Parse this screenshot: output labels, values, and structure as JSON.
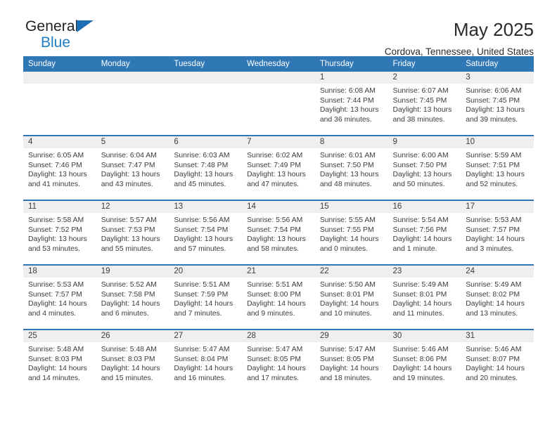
{
  "brand": {
    "name_top": "General",
    "name_bottom": "Blue",
    "triangle_color": "#1b6eb3",
    "blue_text_color": "#1f7fc4"
  },
  "header": {
    "title": "May 2025",
    "location": "Cordova, Tennessee, United States",
    "header_bg_color": "#3077b5",
    "header_text_color": "#ffffff",
    "daynum_band_color": "#efefef"
  },
  "weekday_headers": [
    "Sunday",
    "Monday",
    "Tuesday",
    "Wednesday",
    "Thursday",
    "Friday",
    "Saturday"
  ],
  "weeks": [
    [
      {
        "day": "",
        "sunrise": "",
        "sunset": "",
        "daylight": ""
      },
      {
        "day": "",
        "sunrise": "",
        "sunset": "",
        "daylight": ""
      },
      {
        "day": "",
        "sunrise": "",
        "sunset": "",
        "daylight": ""
      },
      {
        "day": "",
        "sunrise": "",
        "sunset": "",
        "daylight": ""
      },
      {
        "day": "1",
        "sunrise": "Sunrise: 6:08 AM",
        "sunset": "Sunset: 7:44 PM",
        "daylight": "Daylight: 13 hours and 36 minutes."
      },
      {
        "day": "2",
        "sunrise": "Sunrise: 6:07 AM",
        "sunset": "Sunset: 7:45 PM",
        "daylight": "Daylight: 13 hours and 38 minutes."
      },
      {
        "day": "3",
        "sunrise": "Sunrise: 6:06 AM",
        "sunset": "Sunset: 7:45 PM",
        "daylight": "Daylight: 13 hours and 39 minutes."
      }
    ],
    [
      {
        "day": "4",
        "sunrise": "Sunrise: 6:05 AM",
        "sunset": "Sunset: 7:46 PM",
        "daylight": "Daylight: 13 hours and 41 minutes."
      },
      {
        "day": "5",
        "sunrise": "Sunrise: 6:04 AM",
        "sunset": "Sunset: 7:47 PM",
        "daylight": "Daylight: 13 hours and 43 minutes."
      },
      {
        "day": "6",
        "sunrise": "Sunrise: 6:03 AM",
        "sunset": "Sunset: 7:48 PM",
        "daylight": "Daylight: 13 hours and 45 minutes."
      },
      {
        "day": "7",
        "sunrise": "Sunrise: 6:02 AM",
        "sunset": "Sunset: 7:49 PM",
        "daylight": "Daylight: 13 hours and 47 minutes."
      },
      {
        "day": "8",
        "sunrise": "Sunrise: 6:01 AM",
        "sunset": "Sunset: 7:50 PM",
        "daylight": "Daylight: 13 hours and 48 minutes."
      },
      {
        "day": "9",
        "sunrise": "Sunrise: 6:00 AM",
        "sunset": "Sunset: 7:50 PM",
        "daylight": "Daylight: 13 hours and 50 minutes."
      },
      {
        "day": "10",
        "sunrise": "Sunrise: 5:59 AM",
        "sunset": "Sunset: 7:51 PM",
        "daylight": "Daylight: 13 hours and 52 minutes."
      }
    ],
    [
      {
        "day": "11",
        "sunrise": "Sunrise: 5:58 AM",
        "sunset": "Sunset: 7:52 PM",
        "daylight": "Daylight: 13 hours and 53 minutes."
      },
      {
        "day": "12",
        "sunrise": "Sunrise: 5:57 AM",
        "sunset": "Sunset: 7:53 PM",
        "daylight": "Daylight: 13 hours and 55 minutes."
      },
      {
        "day": "13",
        "sunrise": "Sunrise: 5:56 AM",
        "sunset": "Sunset: 7:54 PM",
        "daylight": "Daylight: 13 hours and 57 minutes."
      },
      {
        "day": "14",
        "sunrise": "Sunrise: 5:56 AM",
        "sunset": "Sunset: 7:54 PM",
        "daylight": "Daylight: 13 hours and 58 minutes."
      },
      {
        "day": "15",
        "sunrise": "Sunrise: 5:55 AM",
        "sunset": "Sunset: 7:55 PM",
        "daylight": "Daylight: 14 hours and 0 minutes."
      },
      {
        "day": "16",
        "sunrise": "Sunrise: 5:54 AM",
        "sunset": "Sunset: 7:56 PM",
        "daylight": "Daylight: 14 hours and 1 minute."
      },
      {
        "day": "17",
        "sunrise": "Sunrise: 5:53 AM",
        "sunset": "Sunset: 7:57 PM",
        "daylight": "Daylight: 14 hours and 3 minutes."
      }
    ],
    [
      {
        "day": "18",
        "sunrise": "Sunrise: 5:53 AM",
        "sunset": "Sunset: 7:57 PM",
        "daylight": "Daylight: 14 hours and 4 minutes."
      },
      {
        "day": "19",
        "sunrise": "Sunrise: 5:52 AM",
        "sunset": "Sunset: 7:58 PM",
        "daylight": "Daylight: 14 hours and 6 minutes."
      },
      {
        "day": "20",
        "sunrise": "Sunrise: 5:51 AM",
        "sunset": "Sunset: 7:59 PM",
        "daylight": "Daylight: 14 hours and 7 minutes."
      },
      {
        "day": "21",
        "sunrise": "Sunrise: 5:51 AM",
        "sunset": "Sunset: 8:00 PM",
        "daylight": "Daylight: 14 hours and 9 minutes."
      },
      {
        "day": "22",
        "sunrise": "Sunrise: 5:50 AM",
        "sunset": "Sunset: 8:01 PM",
        "daylight": "Daylight: 14 hours and 10 minutes."
      },
      {
        "day": "23",
        "sunrise": "Sunrise: 5:49 AM",
        "sunset": "Sunset: 8:01 PM",
        "daylight": "Daylight: 14 hours and 11 minutes."
      },
      {
        "day": "24",
        "sunrise": "Sunrise: 5:49 AM",
        "sunset": "Sunset: 8:02 PM",
        "daylight": "Daylight: 14 hours and 13 minutes."
      }
    ],
    [
      {
        "day": "25",
        "sunrise": "Sunrise: 5:48 AM",
        "sunset": "Sunset: 8:03 PM",
        "daylight": "Daylight: 14 hours and 14 minutes."
      },
      {
        "day": "26",
        "sunrise": "Sunrise: 5:48 AM",
        "sunset": "Sunset: 8:03 PM",
        "daylight": "Daylight: 14 hours and 15 minutes."
      },
      {
        "day": "27",
        "sunrise": "Sunrise: 5:47 AM",
        "sunset": "Sunset: 8:04 PM",
        "daylight": "Daylight: 14 hours and 16 minutes."
      },
      {
        "day": "28",
        "sunrise": "Sunrise: 5:47 AM",
        "sunset": "Sunset: 8:05 PM",
        "daylight": "Daylight: 14 hours and 17 minutes."
      },
      {
        "day": "29",
        "sunrise": "Sunrise: 5:47 AM",
        "sunset": "Sunset: 8:05 PM",
        "daylight": "Daylight: 14 hours and 18 minutes."
      },
      {
        "day": "30",
        "sunrise": "Sunrise: 5:46 AM",
        "sunset": "Sunset: 8:06 PM",
        "daylight": "Daylight: 14 hours and 19 minutes."
      },
      {
        "day": "31",
        "sunrise": "Sunrise: 5:46 AM",
        "sunset": "Sunset: 8:07 PM",
        "daylight": "Daylight: 14 hours and 20 minutes."
      }
    ]
  ]
}
